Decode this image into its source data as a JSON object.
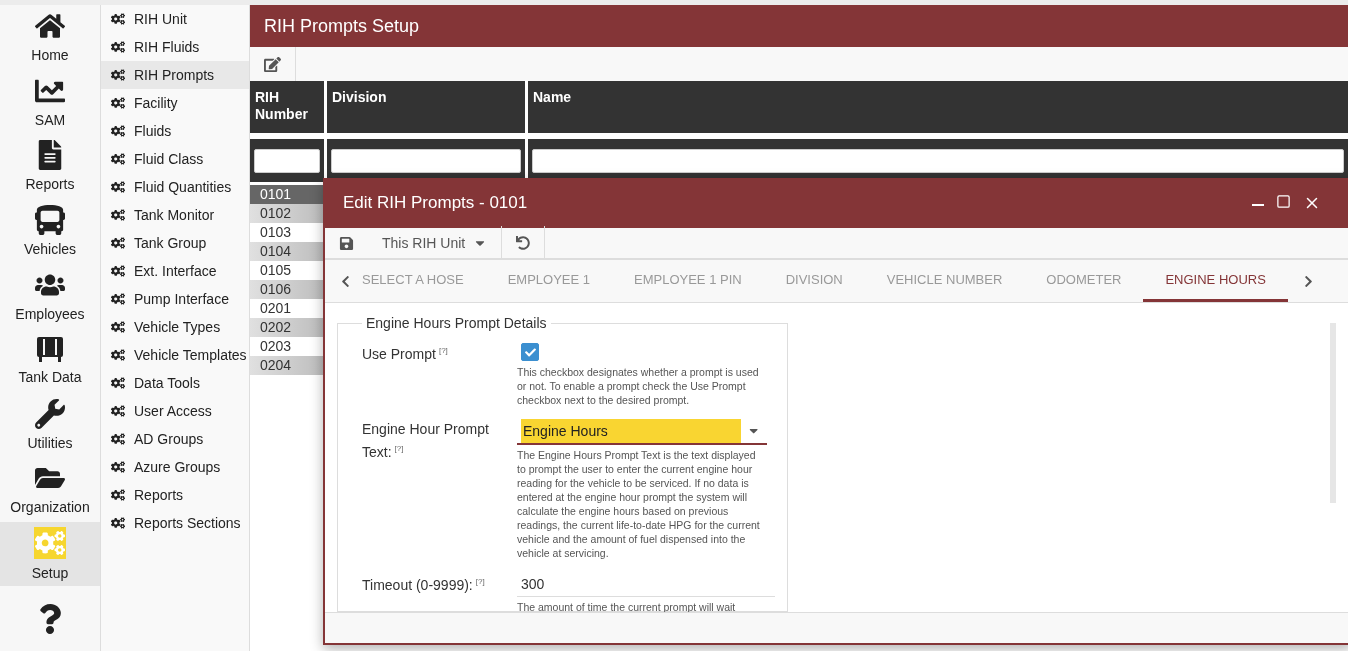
{
  "nav": [
    {
      "kind": "home",
      "label": "Home",
      "selected": false
    },
    {
      "kind": "sam",
      "label": "SAM",
      "selected": false
    },
    {
      "kind": "reports",
      "label": "Reports",
      "selected": false
    },
    {
      "kind": "vehicles",
      "label": "Vehicles",
      "selected": false
    },
    {
      "kind": "employees",
      "label": "Employees",
      "selected": false
    },
    {
      "kind": "tank",
      "label": "Tank Data",
      "selected": false
    },
    {
      "kind": "utilities",
      "label": "Utilities",
      "selected": false
    },
    {
      "kind": "organization",
      "label": "Organization",
      "selected": false
    },
    {
      "kind": "setup",
      "label": "Setup",
      "selected": true
    },
    {
      "kind": "help",
      "selected": false
    }
  ],
  "submenu": [
    {
      "label": "RIH Unit",
      "selected": false
    },
    {
      "label": "RIH Fluids",
      "selected": false
    },
    {
      "label": "RIH Prompts",
      "selected": true
    },
    {
      "label": "Facility",
      "selected": false
    },
    {
      "label": "Fluids",
      "selected": false
    },
    {
      "label": "Fluid Class",
      "selected": false
    },
    {
      "label": "Fluid Quantities",
      "selected": false
    },
    {
      "label": "Tank Monitor",
      "selected": false
    },
    {
      "label": "Tank Group",
      "selected": false
    },
    {
      "label": "Ext. Interface",
      "selected": false
    },
    {
      "label": "Pump Interface",
      "selected": false
    },
    {
      "label": "Vehicle Types",
      "selected": false
    },
    {
      "label": "Vehicle Templates",
      "selected": false
    },
    {
      "label": "Data Tools",
      "selected": false
    },
    {
      "label": "User Access",
      "selected": false
    },
    {
      "label": "AD Groups",
      "selected": false
    },
    {
      "label": "Azure Groups",
      "selected": false
    },
    {
      "label": "Reports",
      "selected": false
    },
    {
      "label": "Reports Sections",
      "selected": false
    }
  ],
  "page": {
    "title": "RIH Prompts Setup"
  },
  "table": {
    "columns": [
      "RIH\nNumber",
      "Division",
      "Name"
    ],
    "rows": [
      {
        "rih_number": "0101",
        "selected": true
      },
      {
        "rih_number": "0102",
        "selected": false
      },
      {
        "rih_number": "0103",
        "selected": false
      },
      {
        "rih_number": "0104",
        "selected": false
      },
      {
        "rih_number": "0105",
        "selected": false
      },
      {
        "rih_number": "0106",
        "selected": false
      },
      {
        "rih_number": "0201",
        "selected": false
      },
      {
        "rih_number": "0202",
        "selected": false
      },
      {
        "rih_number": "0203",
        "selected": false
      },
      {
        "rih_number": "0204",
        "selected": false
      }
    ]
  },
  "dialog": {
    "title": "Edit RIH Prompts - 0101",
    "scope": "This RIH Unit",
    "tabs": [
      {
        "label": "SELECT A HOSE",
        "selected": false
      },
      {
        "label": "EMPLOYEE 1",
        "selected": false
      },
      {
        "label": "EMPLOYEE 1 PIN",
        "selected": false
      },
      {
        "label": "DIVISION",
        "selected": false
      },
      {
        "label": "VEHICLE NUMBER",
        "selected": false
      },
      {
        "label": "ODOMETER",
        "selected": false
      },
      {
        "label": "ENGINE HOURS",
        "selected": true
      }
    ],
    "section": "Engine Hours Prompt Details",
    "fields": [
      {
        "kind": "checkbox",
        "label": "Use Prompt",
        "help_mark": "[?]",
        "checked": true,
        "description": "This checkbox designates whether a prompt is used or not. To enable a prompt check the Use Prompt checkbox next to the desired prompt."
      },
      {
        "kind": "combo",
        "label": "Engine Hour Prompt Text:",
        "help_mark": "[?]",
        "value": "Engine Hours",
        "description": "The Engine Hours Prompt Text is the text displayed to prompt the user to enter the current engine hour reading for the vehicle to be serviced. If no data is entered at the engine hour prompt the system will calculate the engine hours based on previous readings, the current life-to-date HPG for the current vehicle and the amount of fuel dispensed into the vehicle at servicing."
      },
      {
        "kind": "text",
        "label": "Timeout (0-9999):",
        "help_mark": "[?]",
        "value": "300",
        "description": "The amount of time the current prompt will wait"
      }
    ]
  }
}
